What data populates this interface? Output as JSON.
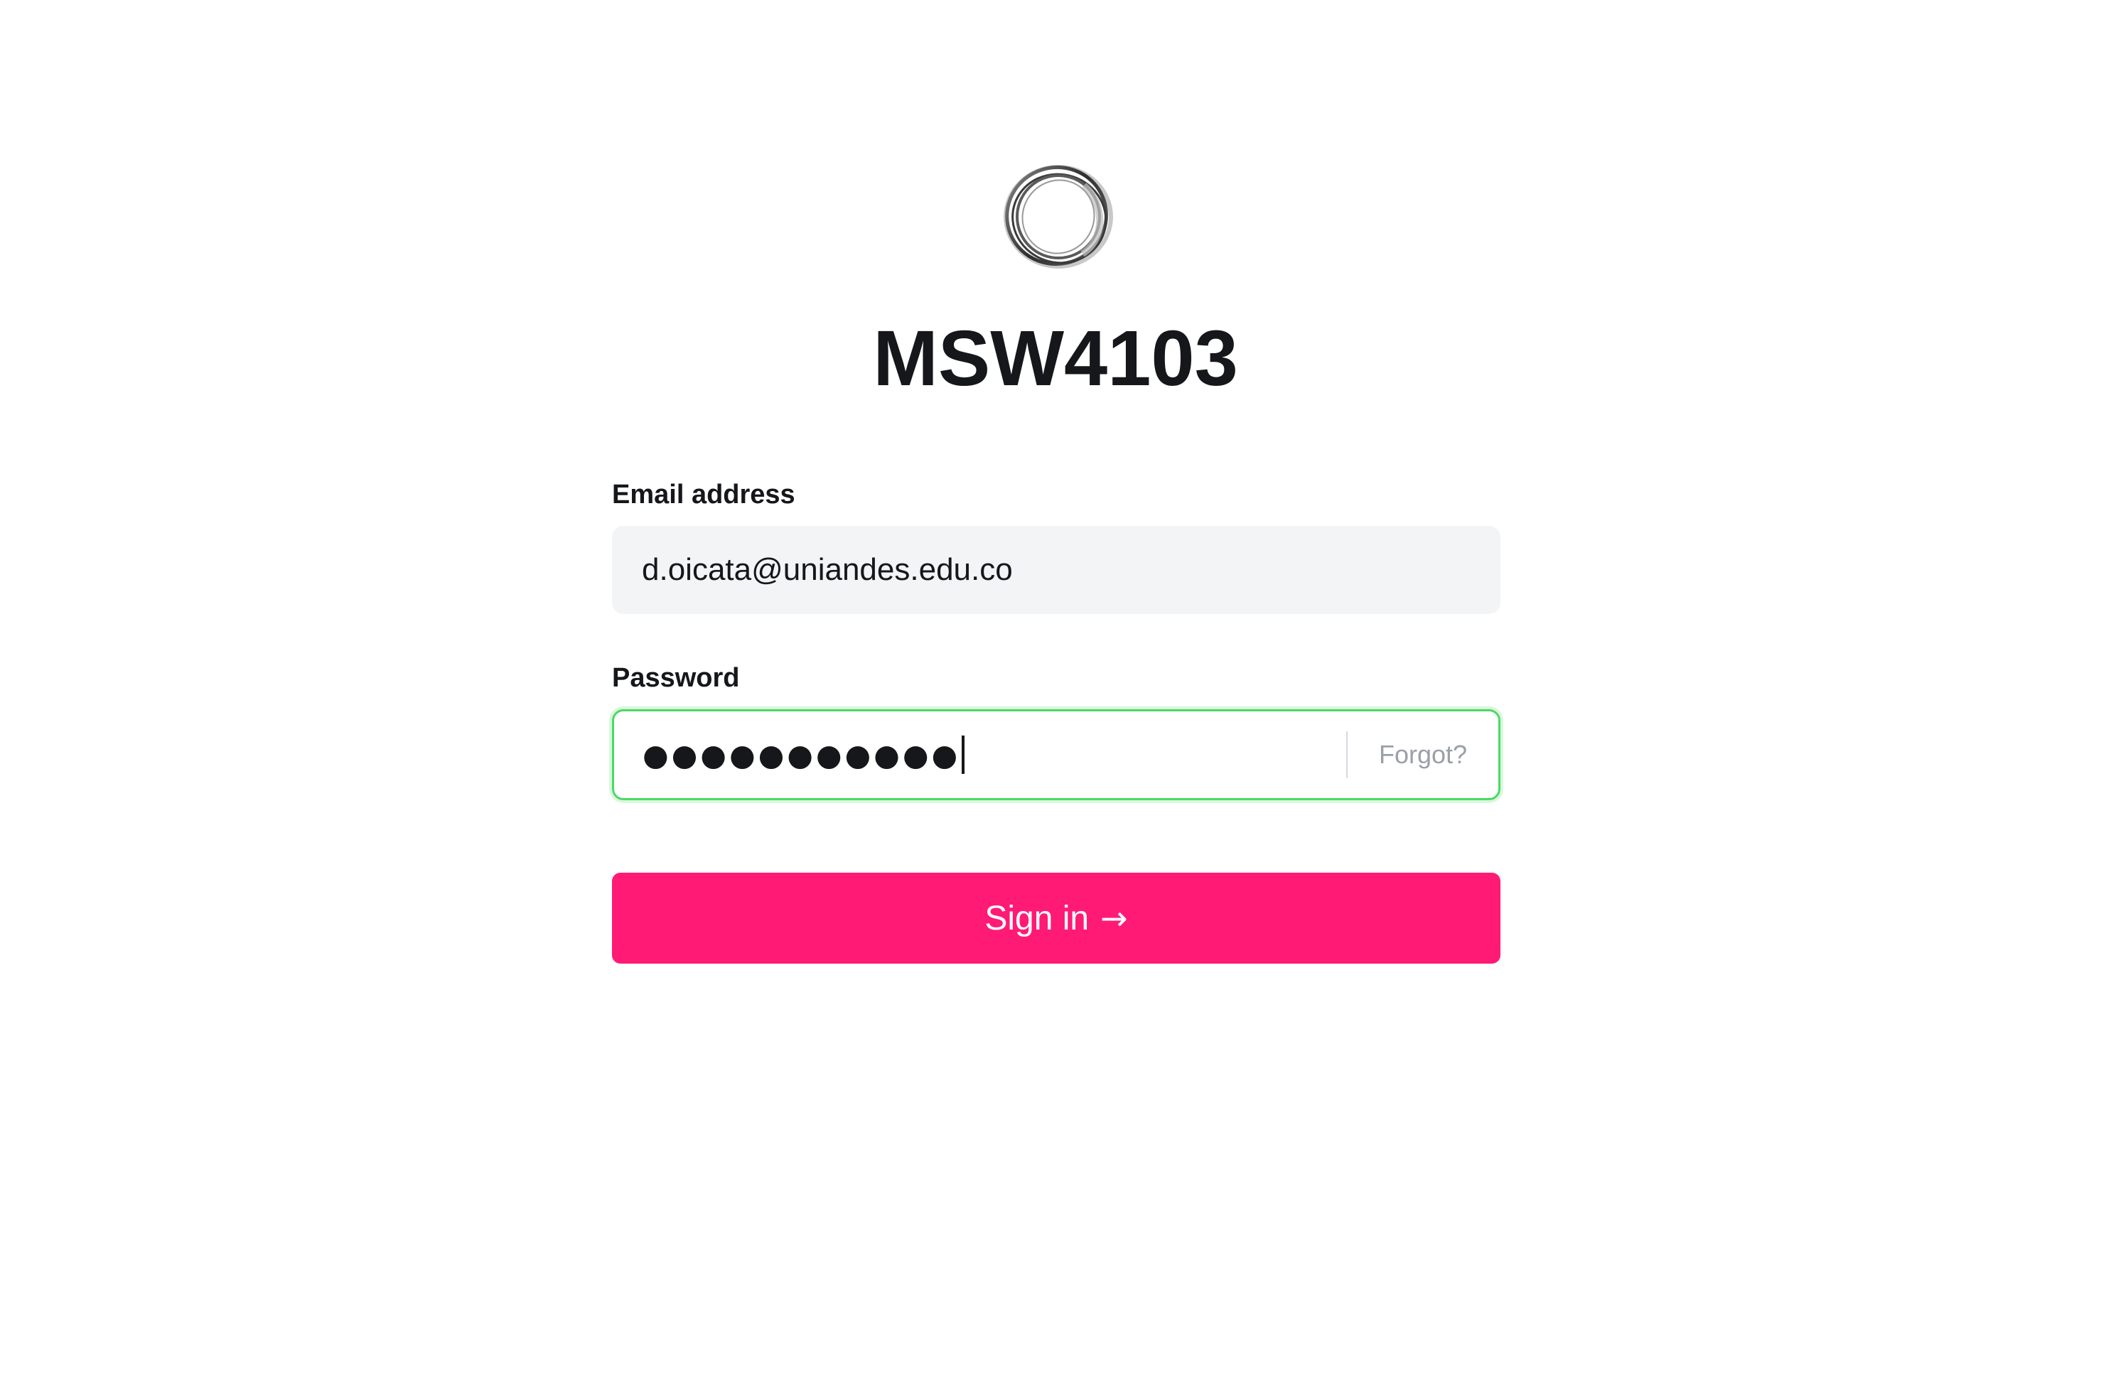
{
  "app": {
    "title": "MSW4103",
    "logo_icon": "ring-logo-icon"
  },
  "form": {
    "email_label": "Email address",
    "email_value": "d.oicata@uniandes.edu.co",
    "password_label": "Password",
    "password_masked": "●●●●●●●●●●●",
    "forgot_label": "Forgot?",
    "signin_label": "Sign in",
    "signin_arrow": "→"
  },
  "colors": {
    "accent": "#ff1a75",
    "focus_border": "#4cd964",
    "field_background": "#f3f4f6",
    "muted_text": "#9aa0a8"
  }
}
